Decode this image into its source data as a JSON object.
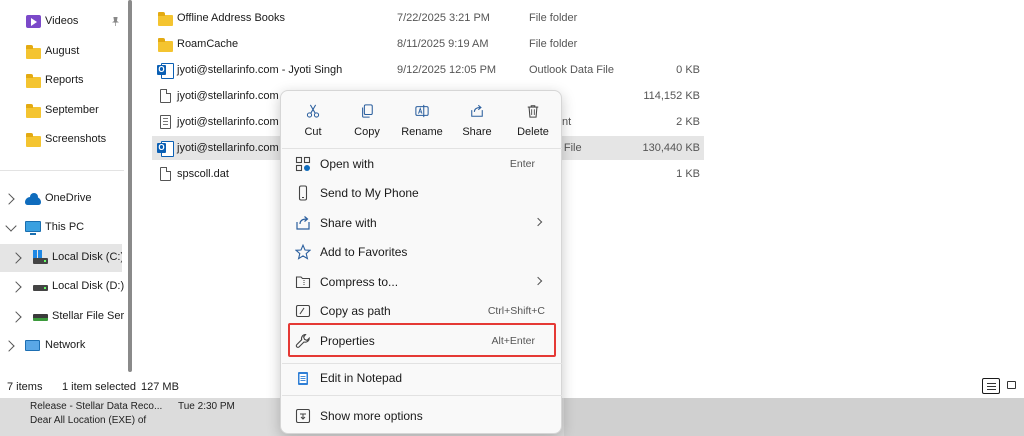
{
  "sidebar": {
    "items": [
      {
        "label": "Videos",
        "icon": "video-icon",
        "pinned": true
      },
      {
        "label": "August",
        "icon": "folder-icon"
      },
      {
        "label": "Reports",
        "icon": "folder-icon"
      },
      {
        "label": "September",
        "icon": "folder-icon"
      },
      {
        "label": "Screenshots",
        "icon": "folder-icon"
      },
      {
        "label": "OneDrive",
        "icon": "cloud-icon"
      },
      {
        "label": "This PC",
        "icon": "pc-icon"
      },
      {
        "label": "Local Disk (C:)",
        "icon": "disk-icon",
        "selected": true
      },
      {
        "label": "Local Disk (D:)",
        "icon": "disk-icon"
      },
      {
        "label": "Stellar File Serv",
        "icon": "network-drive-icon"
      },
      {
        "label": "Network",
        "icon": "network-icon"
      }
    ]
  },
  "files": {
    "rows": [
      {
        "name": "Offline Address Books",
        "date": "7/22/2025 3:21 PM",
        "type": "File folder",
        "size": "",
        "icon": "folder-icon"
      },
      {
        "name": "RoamCache",
        "date": "8/11/2025 9:19 AM",
        "type": "File folder",
        "size": "",
        "icon": "folder-icon"
      },
      {
        "name": "jyoti@stellarinfo.com - Jyoti Singh",
        "date": "9/12/2025 12:05 PM",
        "type": "Outlook Data File",
        "size": "0 KB",
        "icon": "outlook-icon"
      },
      {
        "name": "jyoti@stellarinfo.com",
        "date": "",
        "type": "le",
        "size": "114,152 KB",
        "icon": "file-icon"
      },
      {
        "name": "jyoti@stellarinfo.com",
        "date": "",
        "type": "ocument",
        "size": "2 KB",
        "icon": "doc-icon"
      },
      {
        "name": "jyoti@stellarinfo.com",
        "date": "",
        "type": "k Data File",
        "size": "130,440 KB",
        "icon": "outlook-icon",
        "selected": true
      },
      {
        "name": "spscoll.dat",
        "date": "",
        "type": "le",
        "size": "1 KB",
        "icon": "file-icon"
      }
    ]
  },
  "status": {
    "count": "7 items",
    "selection": "1 item selected",
    "size": "127 MB"
  },
  "bottom": {
    "line1_title": "Release - Stellar Data Reco...",
    "line1_time": "Tue 2:30 PM",
    "line2": "Dear All  Location (EXE) of"
  },
  "context_menu": {
    "quick_actions": [
      {
        "label": "Cut",
        "icon": "scissors-icon"
      },
      {
        "label": "Copy",
        "icon": "copy-icon"
      },
      {
        "label": "Rename",
        "icon": "rename-icon"
      },
      {
        "label": "Share",
        "icon": "share-icon"
      },
      {
        "label": "Delete",
        "icon": "trash-icon"
      }
    ],
    "items": [
      {
        "label": "Open with",
        "shortcut": "Enter",
        "icon": "open-with-icon"
      },
      {
        "label": "Send to My Phone",
        "shortcut": "",
        "icon": "phone-icon"
      },
      {
        "label": "Share with",
        "shortcut": "",
        "submenu": true,
        "icon": "share-with-icon"
      },
      {
        "label": "Add to Favorites",
        "shortcut": "",
        "icon": "star-icon"
      },
      {
        "label": "Compress to...",
        "shortcut": "",
        "submenu": true,
        "icon": "zip-icon"
      },
      {
        "label": "Copy as path",
        "shortcut": "Ctrl+Shift+C",
        "icon": "copy-path-icon"
      },
      {
        "label": "Properties",
        "shortcut": "Alt+Enter",
        "icon": "wrench-icon",
        "highlighted": true
      },
      {
        "label": "Edit in Notepad",
        "shortcut": "",
        "icon": "notepad-icon"
      },
      {
        "label": "Show more options",
        "shortcut": "",
        "icon": "more-options-icon"
      }
    ]
  },
  "colors": {
    "accent": "#0f6cbd",
    "highlight_border": "#e53935",
    "selection_bg": "#e5e5e5",
    "folder": "#f4c430"
  }
}
